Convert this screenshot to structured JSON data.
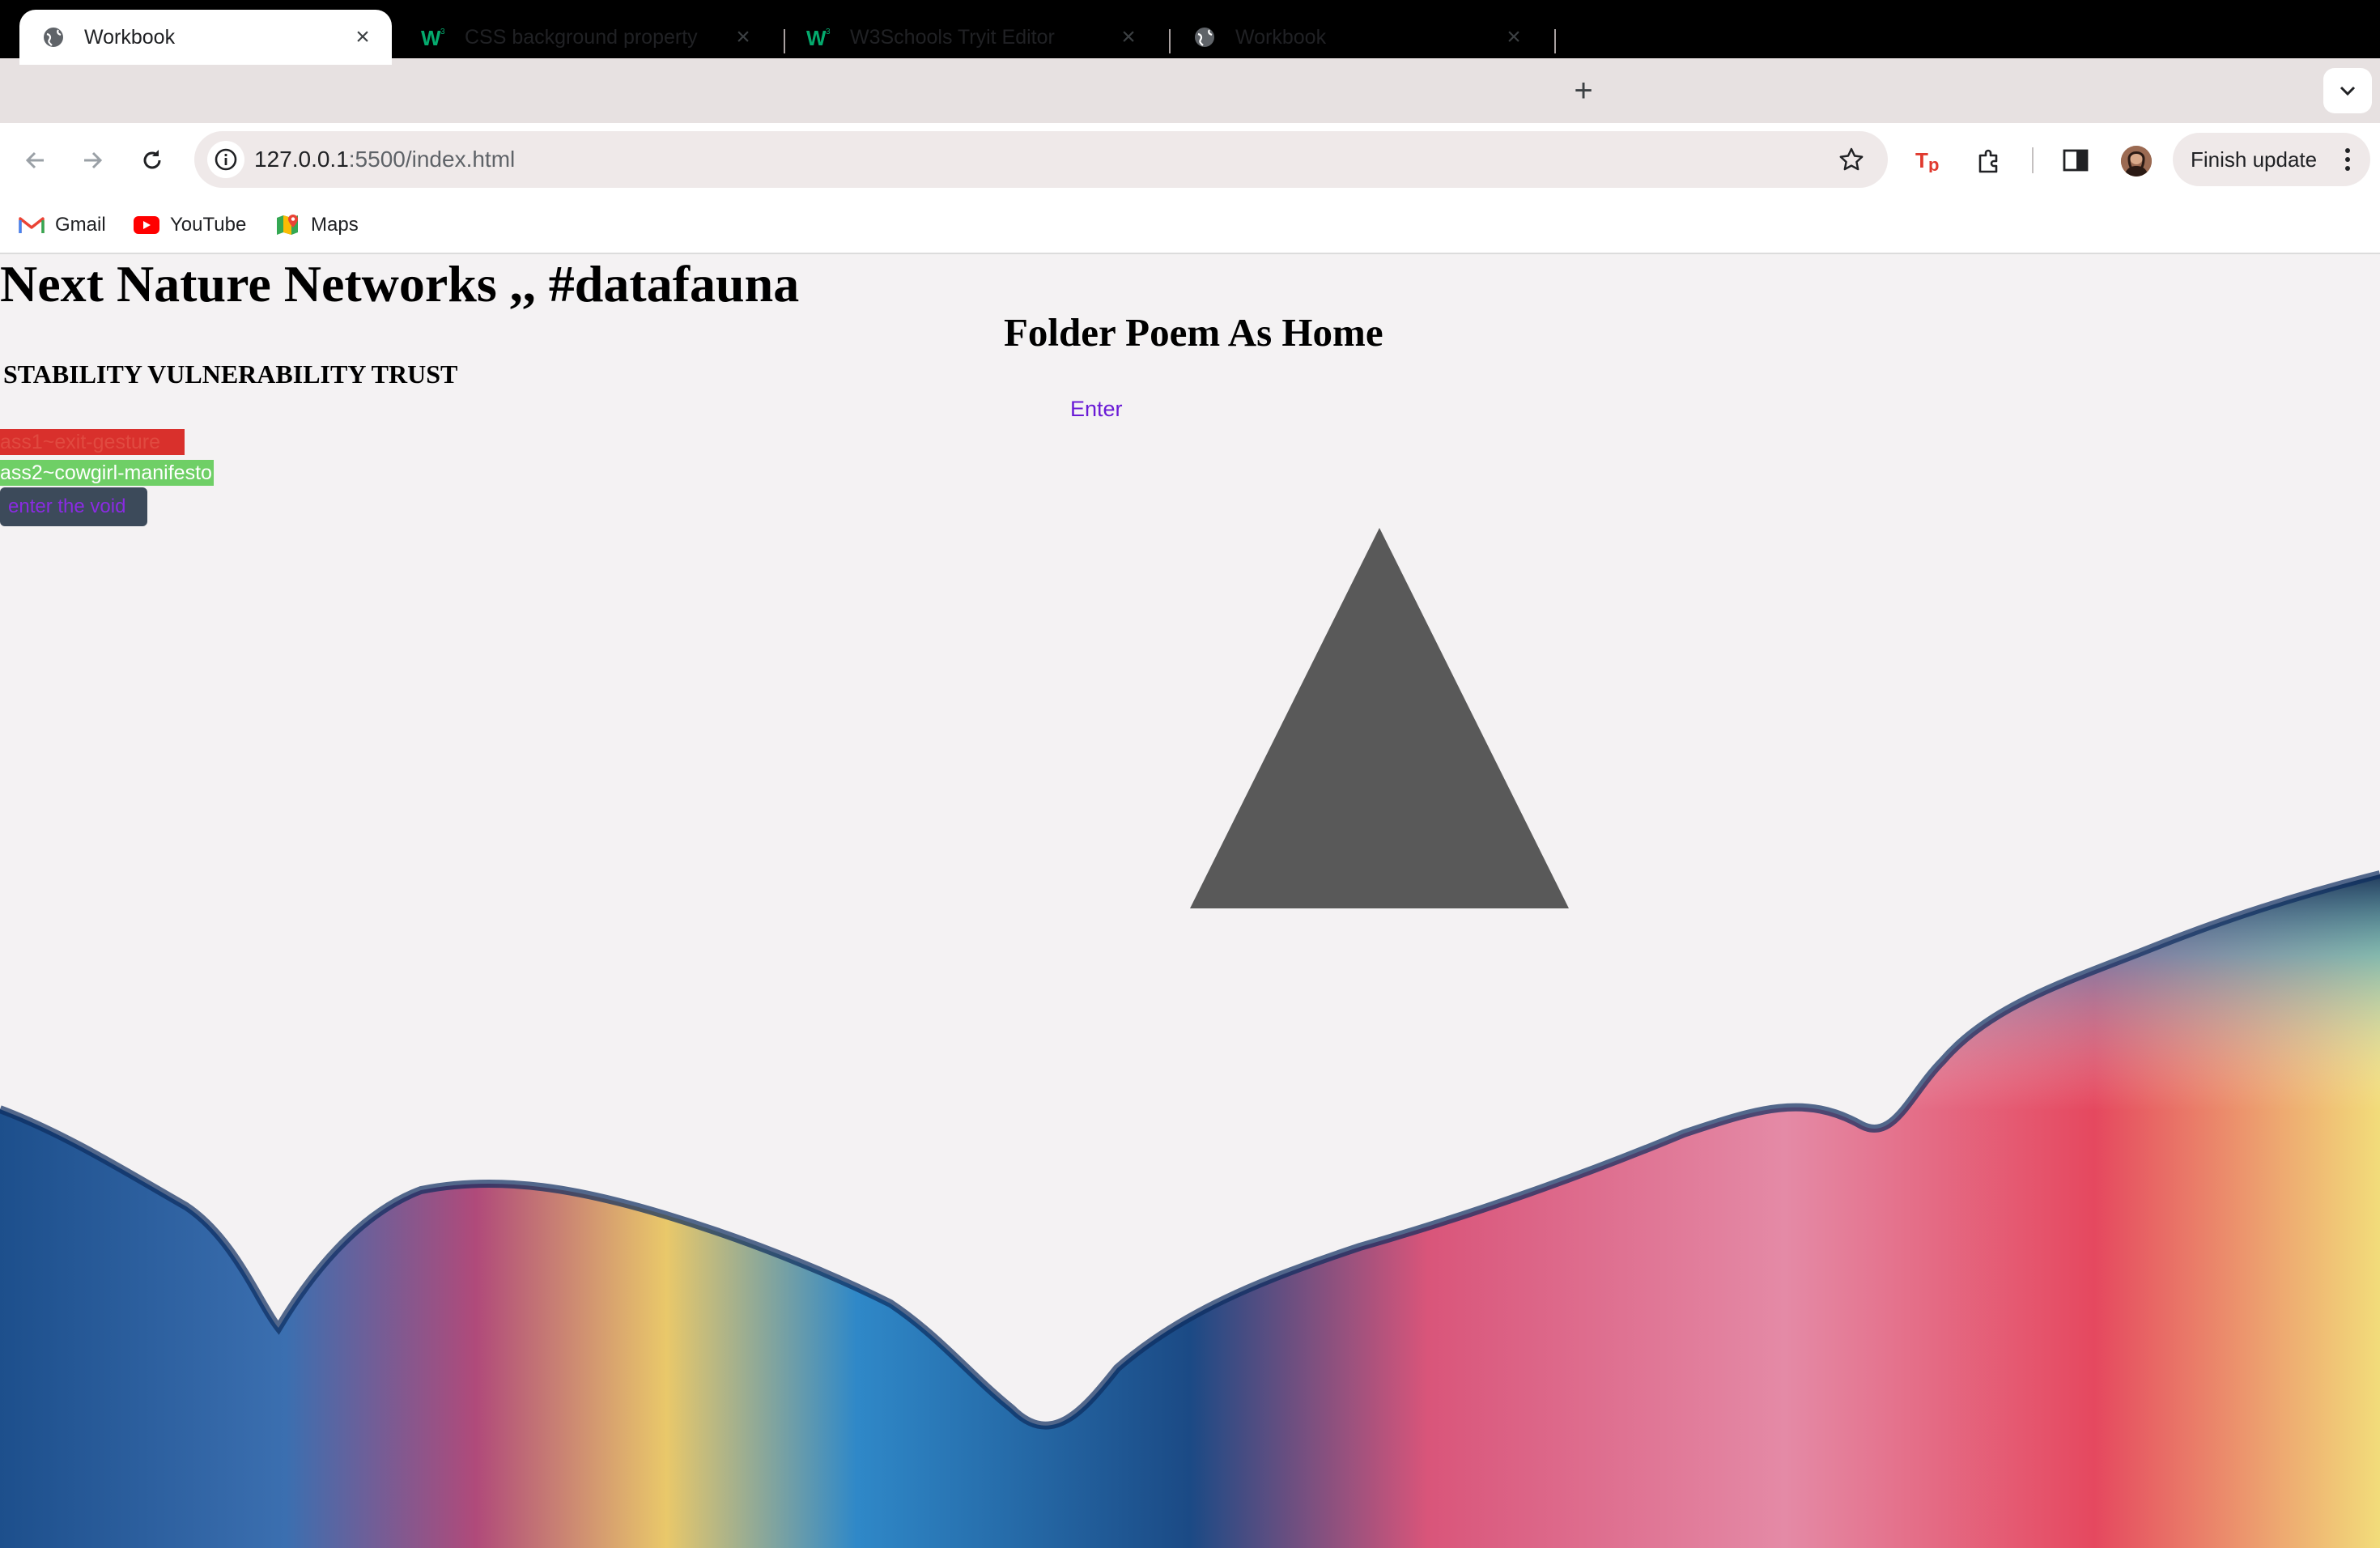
{
  "browser": {
    "tabs": [
      {
        "title": "Workbook",
        "favicon": "globe-icon",
        "active": true
      },
      {
        "title": "CSS background property",
        "favicon": "w3schools-icon",
        "active": false
      },
      {
        "title": "W3Schools Tryit Editor",
        "favicon": "w3schools-icon",
        "active": false
      },
      {
        "title": "Workbook",
        "favicon": "globe-icon",
        "active": false
      }
    ],
    "new_tab_label": "+",
    "address_bar": {
      "host": "127.0.0.1",
      "rest": ":5500/index.html"
    },
    "finish_update_label": "Finish update",
    "bookmarks": [
      {
        "label": "Gmail",
        "icon": "gmail-icon"
      },
      {
        "label": "YouTube",
        "icon": "youtube-icon"
      },
      {
        "label": "Maps",
        "icon": "maps-icon"
      }
    ]
  },
  "page": {
    "site_title": "Next Nature Networks ,, #datafauna",
    "poem_heading": "Folder Poem As Home",
    "themes": "STABILITY VULNERABILITY TRUST",
    "enter_link": "Enter",
    "links": {
      "ass1": "ass1~exit-gesture",
      "ass2": "ass2~cowgirl-manifesto",
      "void_button": "enter the void"
    },
    "colors": {
      "triangle": "#595959",
      "ass1_bg": "#d9302c",
      "ass2_bg": "#6fcf66",
      "void_button_bg": "#3c4a5a",
      "link_purple": "#6a1bd6"
    }
  }
}
